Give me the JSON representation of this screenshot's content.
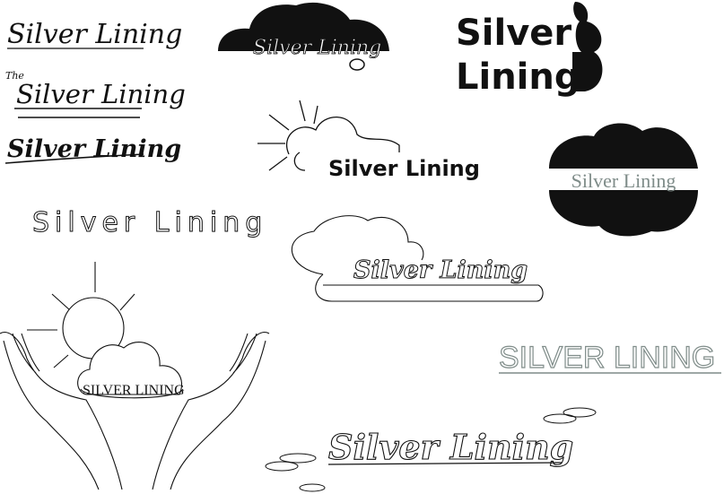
{
  "logos": [
    {
      "id": "script-1",
      "text": "Silver Lining"
    },
    {
      "id": "script-2",
      "prefix": "The",
      "text": "Silver Lining"
    },
    {
      "id": "script-3",
      "text": "Silver Lining"
    },
    {
      "id": "cloud-dark",
      "text": "Silver Lining"
    },
    {
      "id": "bold-stack",
      "line1": "Silver",
      "line2": "Lining"
    },
    {
      "id": "sun-cloud",
      "text": "Silver Lining"
    },
    {
      "id": "cloud-badge",
      "text": "Silver Lining"
    },
    {
      "id": "outline-text",
      "text": "Silver Lining"
    },
    {
      "id": "cloud-outline",
      "text": "Silver Lining"
    },
    {
      "id": "thin-caps",
      "text": "SILVER LINING"
    },
    {
      "id": "hands",
      "text": "SILVER LINING"
    },
    {
      "id": "script-footer",
      "text": "Silver Lining"
    }
  ],
  "colors": {
    "ink": "#111111",
    "grey": "#7f8c89",
    "paper": "#ffffff"
  }
}
